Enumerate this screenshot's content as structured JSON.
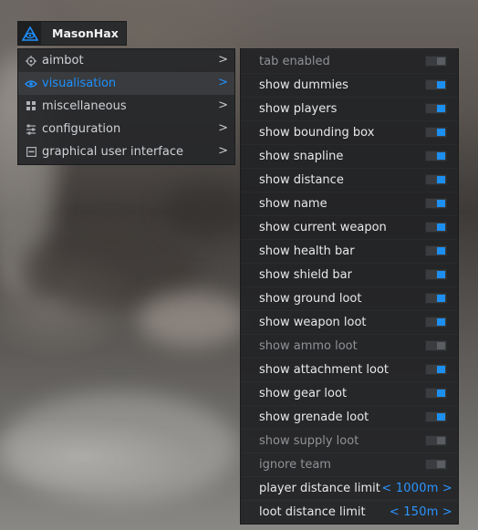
{
  "app": {
    "title": "MasonHax"
  },
  "nav": {
    "items": [
      {
        "label": "aimbot",
        "icon": "crosshair-icon",
        "active": false
      },
      {
        "label": "visualisation",
        "icon": "eye-icon",
        "active": true
      },
      {
        "label": "miscellaneous",
        "icon": "grid-icon",
        "active": false
      },
      {
        "label": "configuration",
        "icon": "sliders-icon",
        "active": false
      },
      {
        "label": "graphical user interface",
        "icon": "window-icon",
        "active": false
      }
    ],
    "arrow": ">"
  },
  "settings": {
    "rows": [
      {
        "label": "tab enabled",
        "type": "toggle",
        "on": false,
        "disabled": true
      },
      {
        "label": "show dummies",
        "type": "toggle",
        "on": true,
        "disabled": false
      },
      {
        "label": "show players",
        "type": "toggle",
        "on": true,
        "disabled": false
      },
      {
        "label": "show bounding box",
        "type": "toggle",
        "on": true,
        "disabled": false
      },
      {
        "label": "show snapline",
        "type": "toggle",
        "on": true,
        "disabled": false
      },
      {
        "label": "show distance",
        "type": "toggle",
        "on": true,
        "disabled": false
      },
      {
        "label": "show name",
        "type": "toggle",
        "on": true,
        "disabled": false
      },
      {
        "label": "show current weapon",
        "type": "toggle",
        "on": true,
        "disabled": false
      },
      {
        "label": "show health bar",
        "type": "toggle",
        "on": true,
        "disabled": false
      },
      {
        "label": "show shield bar",
        "type": "toggle",
        "on": true,
        "disabled": false
      },
      {
        "label": "show ground loot",
        "type": "toggle",
        "on": true,
        "disabled": false
      },
      {
        "label": "show weapon loot",
        "type": "toggle",
        "on": true,
        "disabled": false
      },
      {
        "label": "show ammo loot",
        "type": "toggle",
        "on": false,
        "disabled": true
      },
      {
        "label": "show attachment loot",
        "type": "toggle",
        "on": true,
        "disabled": false
      },
      {
        "label": "show gear loot",
        "type": "toggle",
        "on": true,
        "disabled": false
      },
      {
        "label": "show grenade loot",
        "type": "toggle",
        "on": true,
        "disabled": false
      },
      {
        "label": "show supply loot",
        "type": "toggle",
        "on": false,
        "disabled": true
      },
      {
        "label": "ignore team",
        "type": "toggle",
        "on": false,
        "disabled": true
      },
      {
        "label": "player distance limit",
        "type": "select",
        "value": "< 1000m >",
        "disabled": false
      },
      {
        "label": "loot distance limit",
        "type": "select",
        "value": "< 150m >",
        "disabled": false
      }
    ]
  },
  "colors": {
    "accent": "#1e90ff",
    "panel": "#232426",
    "text": "#e8e9ea",
    "muted": "#8f9296"
  }
}
